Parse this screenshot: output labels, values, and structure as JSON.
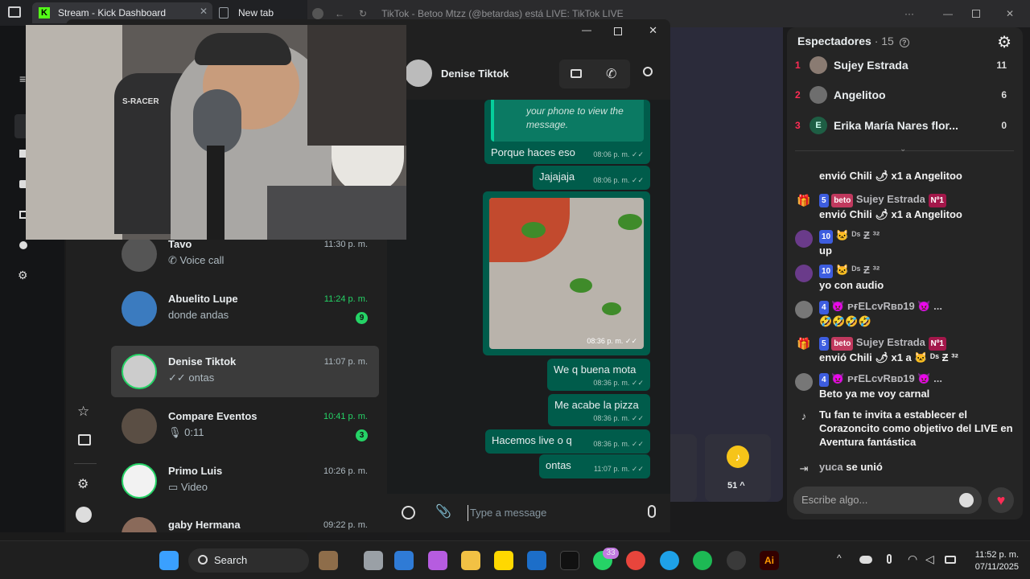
{
  "browser": {
    "tabs": [
      {
        "label": "Stream - Kick Dashboard",
        "favicon": "K"
      },
      {
        "label": "New tab"
      }
    ]
  },
  "tiktok_window": {
    "title": "TikTok - Betoo Mtzz (@betardas) está LIVE: TikTok LIVE",
    "gift_count": "51"
  },
  "viewers": {
    "title": "Espectadores",
    "count": "· 15",
    "list": [
      {
        "rank": "1",
        "name": "Sujey Estrada",
        "score": "11"
      },
      {
        "rank": "2",
        "name": "Angelitoo",
        "score": "6"
      },
      {
        "rank": "3",
        "name": "Erika María Nares flor...",
        "score": "0",
        "initial": "E"
      }
    ]
  },
  "live_chat": {
    "messages": [
      {
        "text": "envió Chili 🌶 x1 a Angelitoo"
      },
      {
        "level": "5",
        "team": "beto",
        "user": "Sujey Estrada",
        "rank_badge": "Nº1",
        "text": "envió Chili 🌶 x1 a Angelitoo"
      },
      {
        "level": "10",
        "user": "🐱 ᴰˢ Ƶ ³²",
        "text": "up"
      },
      {
        "level": "10",
        "user": "🐱 ᴰˢ Ƶ ³²",
        "text": "yo con audio"
      },
      {
        "level": "4",
        "user": "👿 ᴘғELᴄᴠRʙᴅ19 👿 ...",
        "text": "🤣🤣🤣🤣"
      },
      {
        "level": "5",
        "team": "beto",
        "user": "Sujey Estrada",
        "rank_badge": "Nº1",
        "text": "envió Chili 🌶 x1 a 🐱 ᴰˢ Ƶ ³²"
      },
      {
        "level": "4",
        "user": "👿 ᴘғELᴄᴠRʙᴅ19 👿 ...",
        "text": "Beto ya me voy carnal"
      },
      {
        "text": "Tu fan te invita a establecer el Corazoncito como objetivo del LIVE en Aventura fantástica"
      },
      {
        "user": "yuca",
        "text": "se unió"
      }
    ],
    "input_placeholder": "Escribe algo..."
  },
  "whatsapp": {
    "contact_name": "Denise Tiktok",
    "chats": [
      {
        "name": "Tavo",
        "preview": "Voice call",
        "time": "11:30 p. m.",
        "icon": "phone-icon"
      },
      {
        "name": "Abuelito Lupe",
        "preview": "donde andas",
        "time": "11:24 p. m.",
        "unread": "9"
      },
      {
        "name": "Denise Tiktok",
        "preview": "ontas",
        "time": "11:07 p. m.",
        "icon": "double-check-icon",
        "active": true
      },
      {
        "name": "Compare Eventos",
        "preview": "0:11",
        "time": "10:41 p. m.",
        "unread": "3",
        "icon": "mic-icon"
      },
      {
        "name": "Primo Luis",
        "preview": "Video",
        "time": "10:26 p. m.",
        "icon": "video-icon"
      },
      {
        "name": "gaby Hermana",
        "preview": "",
        "time": "09:22 p. m."
      }
    ],
    "messages": [
      {
        "text": "your phone to view the message.",
        "time": "",
        "quoted": true
      },
      {
        "text": "Porque haces eso",
        "time": "08:06 p. m."
      },
      {
        "text": "Jajajaja",
        "time": "08:06 p. m."
      },
      {
        "text": "",
        "time": "08:36 p. m.",
        "image": true
      },
      {
        "text": "We q buena mota",
        "time": "08:36 p. m."
      },
      {
        "text": "Me acabe la pizza",
        "time": "08:36 p. m."
      },
      {
        "text": "Hacemos live o q",
        "time": "08:36 p. m."
      },
      {
        "text": "ontas",
        "time": "11:07 p. m."
      }
    ],
    "compose_placeholder": "Type a message"
  },
  "taskbar": {
    "search_label": "Search",
    "whatsapp_badge": "33",
    "time": "11:52 p. m.",
    "date": "07/11/2025"
  },
  "colors": {
    "whatsapp_green": "#25d366",
    "bubble": "#005c4b",
    "tiktok_pink": "#fe2c55"
  }
}
